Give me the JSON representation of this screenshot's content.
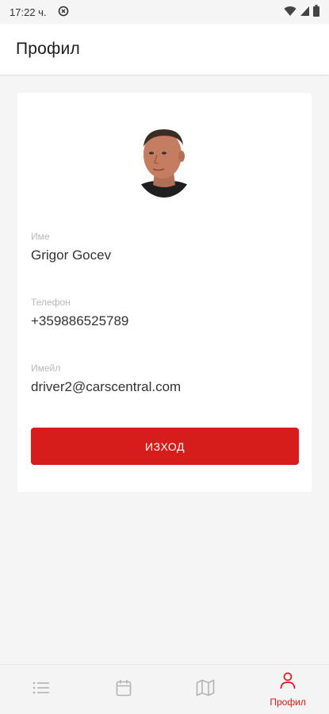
{
  "status_bar": {
    "time": "17:22 ч.",
    "icons": [
      "sync-icon",
      "wifi-icon",
      "signal-icon",
      "battery-icon"
    ]
  },
  "app_bar": {
    "title": "Профил"
  },
  "profile": {
    "fields": [
      {
        "label": "Име",
        "value": "Grigor Gocev"
      },
      {
        "label": "Телефон",
        "value": "+359886525789"
      },
      {
        "label": "Имейл",
        "value": "driver2@carscentral.com"
      }
    ],
    "logout_label": "изход"
  },
  "bottom_nav": {
    "items": [
      {
        "icon": "list-icon",
        "label": ""
      },
      {
        "icon": "calendar-icon",
        "label": ""
      },
      {
        "icon": "map-icon",
        "label": ""
      },
      {
        "icon": "person-icon",
        "label": "Профил"
      }
    ],
    "active_index": 3
  },
  "colors": {
    "accent": "#d71c1c",
    "background": "#f5f5f5",
    "card": "#ffffff",
    "inactive_icon": "#b3b3b3"
  }
}
